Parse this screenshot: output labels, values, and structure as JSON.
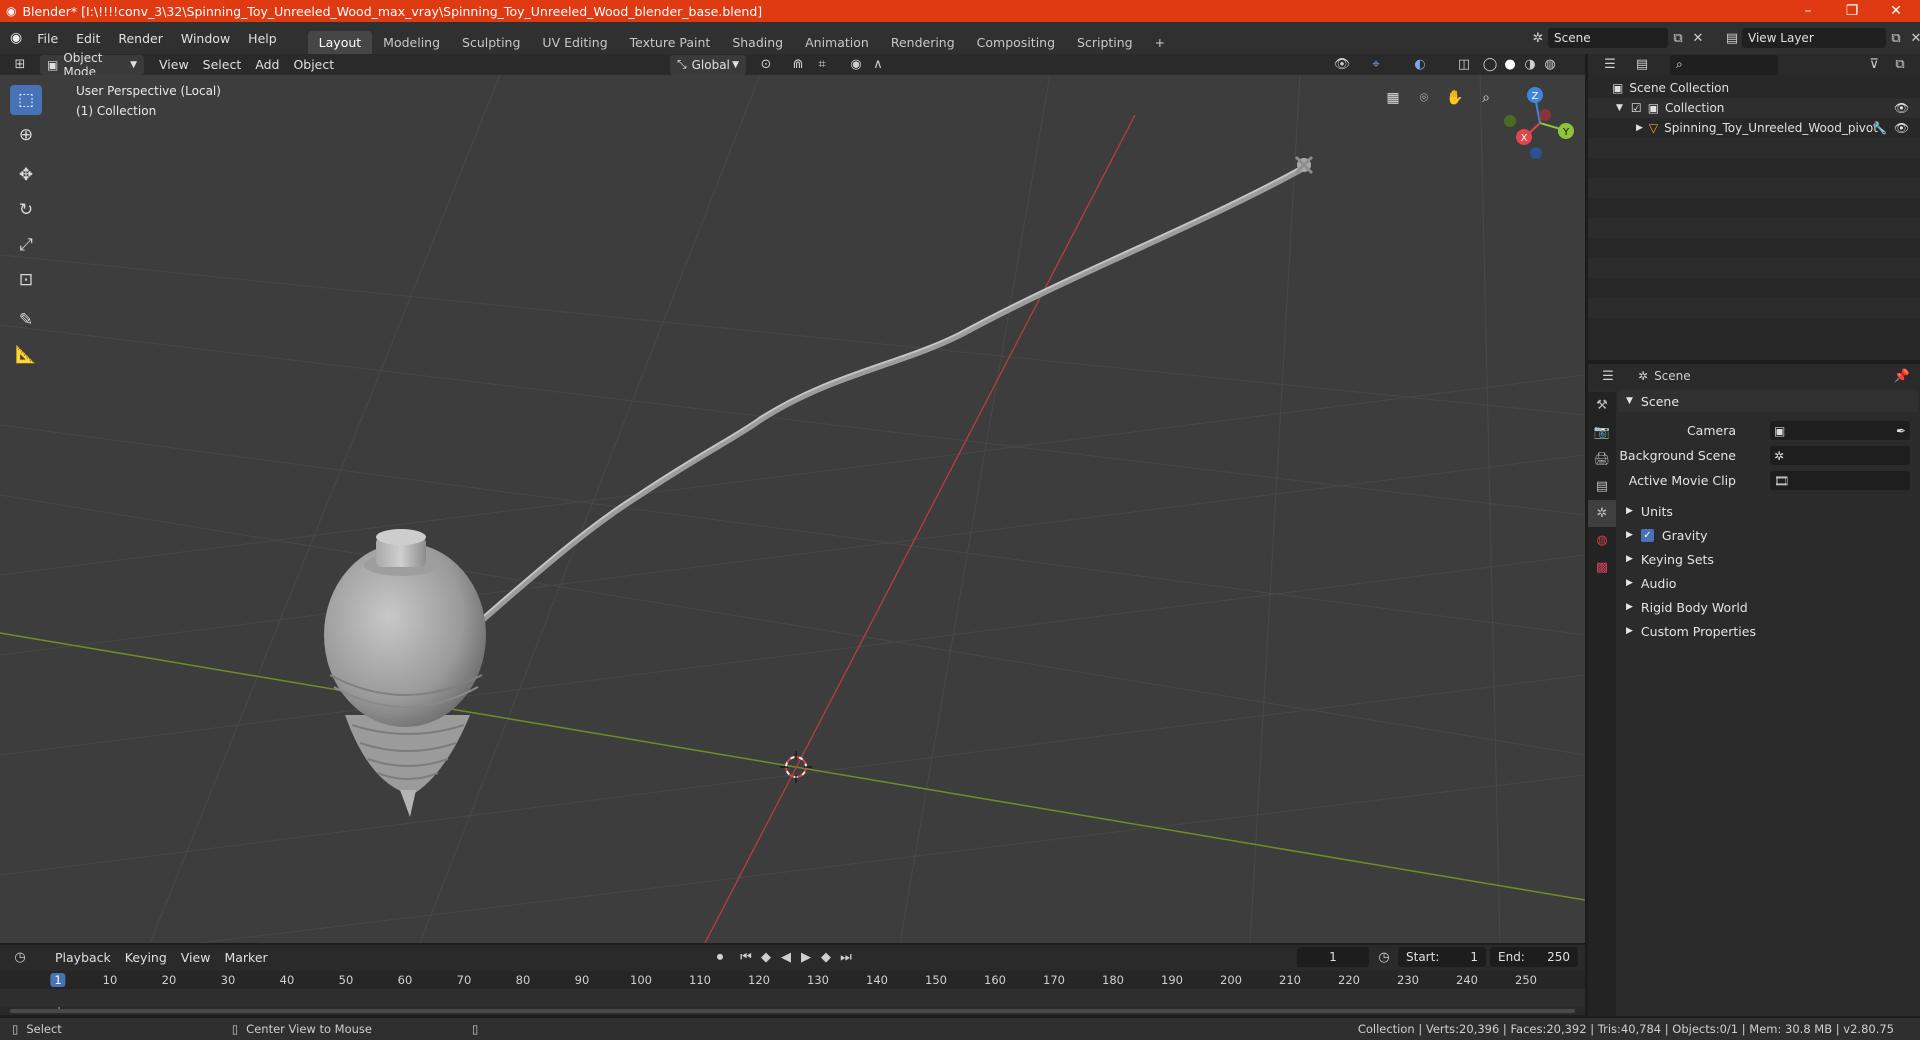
{
  "window": {
    "title": "Blender* [I:\\!!!!conv_3\\32\\Spinning_Toy_Unreeled_Wood_max_vray\\Spinning_Toy_Unreeled_Wood_blender_base.blend]",
    "minimize": "–",
    "maximize": "❐",
    "close": "✕"
  },
  "menubar": {
    "items": [
      "File",
      "Edit",
      "Render",
      "Window",
      "Help"
    ],
    "workspaces": [
      "Layout",
      "Modeling",
      "Sculpting",
      "UV Editing",
      "Texture Paint",
      "Shading",
      "Animation",
      "Rendering",
      "Compositing",
      "Scripting"
    ],
    "add_workspace": "+",
    "scene_name": "Scene",
    "view_layer": "View Layer"
  },
  "viewport_header": {
    "mode": "Object Mode",
    "menus": [
      "View",
      "Select",
      "Add",
      "Object"
    ],
    "transform_orientation": "Global"
  },
  "viewport": {
    "perspective_label": "User Perspective (Local)",
    "collection_label": "(1) Collection",
    "gizmo_axes": [
      "Z",
      "Y",
      "X"
    ]
  },
  "outliner": {
    "search_placeholder": "",
    "root": "Scene Collection",
    "collection": "Collection",
    "object": "Spinning_Toy_Unreeled_Wood_pivot"
  },
  "properties": {
    "context": "Scene",
    "panel_title": "Scene",
    "camera_label": "Camera",
    "background_scene_label": "Background Scene",
    "active_movie_clip_label": "Active Movie Clip",
    "sections": [
      "Units",
      "Gravity",
      "Keying Sets",
      "Audio",
      "Rigid Body World",
      "Custom Properties"
    ],
    "gravity_enabled": true
  },
  "timeline": {
    "menus": [
      "Playback",
      "Keying",
      "View",
      "Marker"
    ],
    "current_frame": "1",
    "start_label": "Start:",
    "start": "1",
    "end_label": "End:",
    "end": "250",
    "ruler": [
      "1",
      "10",
      "20",
      "30",
      "40",
      "50",
      "60",
      "70",
      "80",
      "90",
      "100",
      "110",
      "120",
      "130",
      "140",
      "150",
      "160",
      "170",
      "180",
      "190",
      "200",
      "210",
      "220",
      "230",
      "240",
      "250"
    ]
  },
  "statusbar": {
    "left_action": "Select",
    "middle_action": "Center View to Mouse",
    "stats": "Collection | Verts:20,396 | Faces:20,392 | Tris:40,784 | Objects:0/1 | Mem: 30.8 MB | v2.80.75"
  },
  "colors": {
    "title_bar": "#e03a12",
    "accent_blue": "#4872b8",
    "axis_x": "#e0464c",
    "axis_y": "#8dc43a",
    "axis_z": "#3f85e0"
  }
}
